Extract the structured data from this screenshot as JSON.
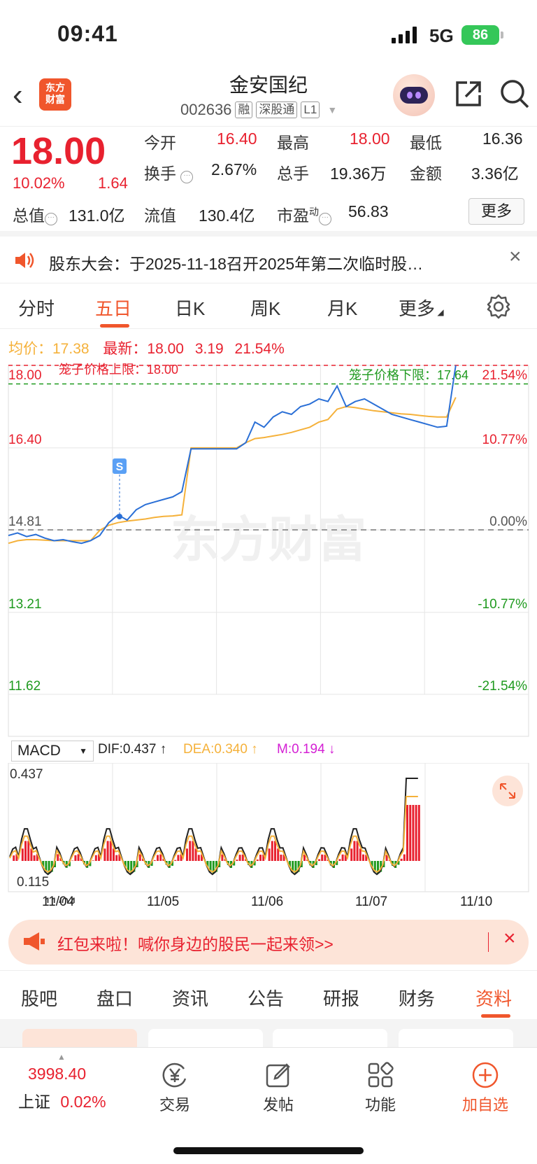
{
  "status": {
    "time": "09:41",
    "network": "5G",
    "battery": "86"
  },
  "header": {
    "logo_line1": "东方",
    "logo_line2": "财富",
    "stock_name": "金安国纪",
    "stock_code": "002636",
    "tags": [
      "融",
      "深股通",
      "L1"
    ]
  },
  "quote": {
    "price": "18.00",
    "change_pct": "10.02%",
    "change_val": "1.64",
    "open_label": "今开",
    "open": "16.40",
    "high_label": "最高",
    "high": "18.00",
    "low_label": "最低",
    "low": "16.36",
    "turnover_label": "换手",
    "turnover": "2.67%",
    "volume_label": "总手",
    "volume": "19.36万",
    "amount_label": "金额",
    "amount": "3.36亿",
    "mktcap_label": "总值",
    "mktcap": "131.0亿",
    "float_label": "流值",
    "float": "130.4亿",
    "pe_label": "市盈",
    "pe_sup": "动",
    "pe": "56.83",
    "more": "更多"
  },
  "notice": {
    "text": "股东大会：于2025-11-18召开2025年第二次临时股…"
  },
  "chart_tabs": [
    "分时",
    "五日",
    "日K",
    "周K",
    "月K",
    "更多"
  ],
  "chart_tab_active": "五日",
  "avg_line": {
    "avg_label": "均价：",
    "avg": "17.38",
    "latest_label": "最新：",
    "latest": "18.00",
    "chg": "3.19",
    "chg_pct": "21.54%"
  },
  "chart_data": {
    "type": "line",
    "x_labels": [
      "11/04",
      "11/05",
      "11/06",
      "11/07",
      "11/10"
    ],
    "y_left": [
      "18.00",
      "16.40",
      "14.81",
      "13.21",
      "11.62"
    ],
    "y_right": [
      "21.54%",
      "10.77%",
      "0.00%",
      "-10.77%",
      "-21.54%"
    ],
    "upper_limit_label": "笼子价格上限：18.00",
    "lower_limit_label": "笼子价格下限：17.64",
    "prev_close": 14.81,
    "ylim": [
      11.62,
      18.0
    ],
    "watermark": "东方财富",
    "marker": "S",
    "series": [
      {
        "values": [
          14.7,
          14.75,
          14.68,
          14.72,
          14.65,
          14.6,
          14.62,
          14.58,
          14.55,
          14.6,
          14.7,
          14.95,
          15.1,
          15.0,
          15.2,
          15.3,
          15.35,
          15.4,
          15.45,
          15.55,
          16.38,
          16.38,
          16.38,
          16.38,
          16.38,
          16.38,
          16.5,
          16.9,
          16.8,
          17.0,
          17.1,
          17.05,
          17.2,
          17.25,
          17.35,
          17.3,
          17.6,
          17.2,
          17.3,
          17.35,
          17.25,
          17.15,
          17.05,
          17.0,
          16.95,
          16.9,
          16.85,
          16.8,
          16.82,
          18.0
        ]
      },
      {
        "values": [
          14.55,
          14.6,
          14.62,
          14.62,
          14.61,
          14.6,
          14.6,
          14.6,
          14.6,
          14.6,
          14.8,
          14.9,
          14.95,
          14.98,
          15.0,
          15.02,
          15.05,
          15.07,
          15.08,
          15.1,
          16.4,
          16.4,
          16.4,
          16.4,
          16.4,
          16.4,
          16.5,
          16.58,
          16.6,
          16.63,
          16.66,
          16.7,
          16.75,
          16.8,
          16.9,
          16.95,
          17.15,
          17.2,
          17.18,
          17.15,
          17.12,
          17.1,
          17.08,
          17.06,
          17.05,
          17.03,
          17.01,
          17.0,
          17.0,
          17.38
        ]
      }
    ]
  },
  "macd": {
    "name": "MACD",
    "dif": "DIF:0.437 ↑",
    "dea": "DEA:0.340 ↑",
    "m": "M:0.194 ↓",
    "ymax": "0.437",
    "ymin": "0.115"
  },
  "banner": {
    "text": "红包来啦！喊你身边的股民一起来领>>"
  },
  "bottom_tabs": [
    "股吧",
    "盘口",
    "资讯",
    "公告",
    "研报",
    "财务",
    "资料"
  ],
  "bottom_tab_active": "资料",
  "bottom_nav": {
    "index_value": "3998.40",
    "index_name": "上证",
    "index_pct": "0.02%",
    "trade": "交易",
    "post": "发帖",
    "func": "功能",
    "add": "加自选"
  },
  "colors": {
    "accent": "#f0562c",
    "up": "#e8212f",
    "down": "#1f9a1f",
    "price_line": "#2a6fd6",
    "avg_line": "#f5b13a"
  }
}
